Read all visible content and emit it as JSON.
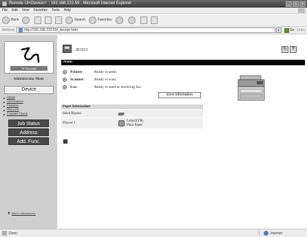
{
  "browser": {
    "title": "Remote UI<Device>: : 192.168.222.59 - Microsoft Internet Explorer",
    "menu": [
      "File",
      "Edit",
      "View",
      "Favorites",
      "Tools",
      "Help"
    ],
    "toolbar": {
      "back": "Back",
      "search": "Search",
      "favorites": "Favorites"
    },
    "address_label": "Address",
    "address_value": "http://192.168.222.59/_devnpr.html",
    "go_label": "Go",
    "links_label": "Links",
    "status_text": "Done",
    "zone_text": "Internet"
  },
  "sidebar": {
    "logo_caption": "To Top page",
    "mode": "Administrator Mode",
    "device_button": "Device",
    "nav_items": [
      "Status",
      "Information",
      "Features",
      "Network",
      "Counter Check"
    ],
    "job_status": "Job Status",
    "address": "Address",
    "add_func": "Add. Func.",
    "mail_link": "Mail to Administrator"
  },
  "main": {
    "device_name": "iR1023",
    "section_title": "Status",
    "status": [
      {
        "label": "Printer:",
        "value": "Ready to print."
      },
      {
        "label": "Scanner:",
        "value": "Ready to scan."
      },
      {
        "label": "Fax:",
        "value": "Ready to send or receiving fax."
      }
    ],
    "error_button": "Error Information",
    "paper": {
      "header": "Paper Information",
      "rows": [
        {
          "source": "Stack Bypass",
          "size": "",
          "type": ""
        },
        {
          "source": "Drawer 1",
          "size": "Letter(LTR)",
          "type": "Plain Paper"
        }
      ]
    }
  }
}
